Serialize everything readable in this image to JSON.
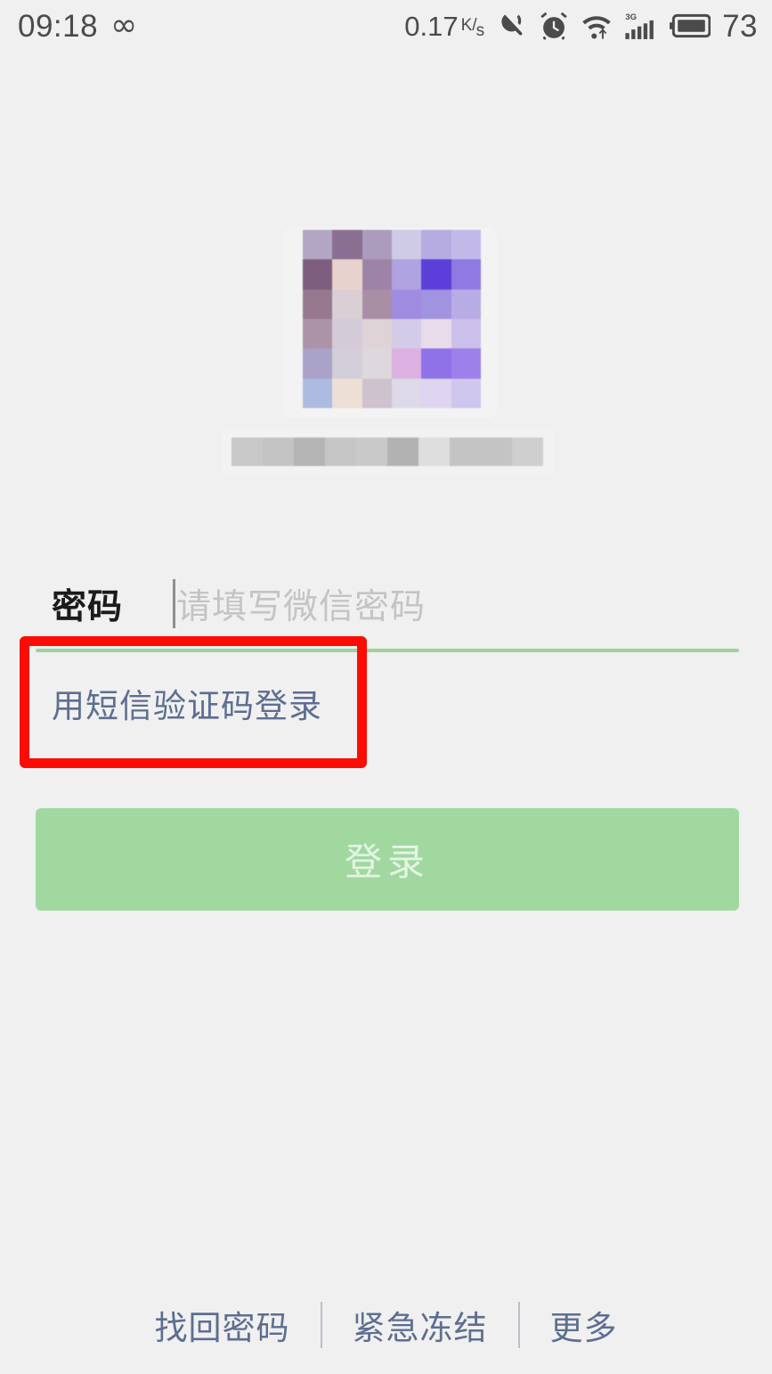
{
  "status_bar": {
    "time": "09:18",
    "infinity_glyph": "∞",
    "net_speed_value": "0.17",
    "net_speed_unit_top": "K",
    "net_speed_unit_bottom": "s",
    "net_speed_slash": "/",
    "icons": [
      "vibrate-icon",
      "alarm-clock-icon",
      "wifi-icon",
      "signal-3g-icon",
      "battery-icon"
    ],
    "signal_label": "3G",
    "battery_level": "73"
  },
  "profile": {
    "avatar": "censored-avatar-mosaic",
    "nickname": "censored-nickname-mosaic"
  },
  "form": {
    "password_label": "密码",
    "password_value": "",
    "password_placeholder": "请填写微信密码",
    "sms_login_link": "用短信验证码登录",
    "login_button": "登录"
  },
  "footer": {
    "links": [
      {
        "label": "找回密码"
      },
      {
        "label": "紧急冻结"
      },
      {
        "label": "更多"
      }
    ]
  },
  "annotation": {
    "type": "red-rectangle-highlight",
    "target": "用短信验证码登录",
    "color": "#fb0d05"
  },
  "colors": {
    "background": "#f0f0f0",
    "accent_green": "#9ed49b",
    "button_green": "#a1d8a0",
    "link_blue": "#5d6e91",
    "placeholder_gray": "#c4c4c4",
    "annotation_red": "#fb0d05"
  }
}
